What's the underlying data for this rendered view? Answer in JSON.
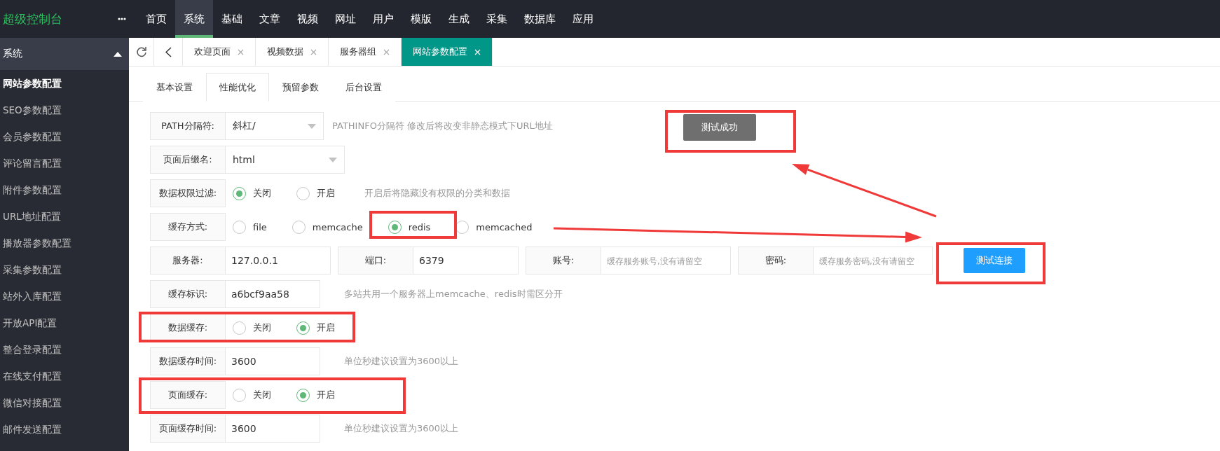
{
  "topbar": {
    "logo": "超级控制台",
    "menu": [
      {
        "label": "首页",
        "selected": false
      },
      {
        "label": "系统",
        "selected": true
      },
      {
        "label": "基础",
        "selected": false
      },
      {
        "label": "文章",
        "selected": false
      },
      {
        "label": "视频",
        "selected": false
      },
      {
        "label": "网址",
        "selected": false
      },
      {
        "label": "用户",
        "selected": false
      },
      {
        "label": "模版",
        "selected": false
      },
      {
        "label": "生成",
        "selected": false
      },
      {
        "label": "采集",
        "selected": false
      },
      {
        "label": "数据库",
        "selected": false
      },
      {
        "label": "应用",
        "selected": false
      }
    ]
  },
  "sidebar": {
    "title": "系统",
    "expanded": true,
    "items": [
      {
        "label": "网站参数配置",
        "selected": true
      },
      {
        "label": "SEO参数配置",
        "selected": false
      },
      {
        "label": "会员参数配置",
        "selected": false
      },
      {
        "label": "评论留言配置",
        "selected": false
      },
      {
        "label": "附件参数配置",
        "selected": false
      },
      {
        "label": "URL地址配置",
        "selected": false
      },
      {
        "label": "播放器参数配置",
        "selected": false
      },
      {
        "label": "采集参数配置",
        "selected": false
      },
      {
        "label": "站外入库配置",
        "selected": false
      },
      {
        "label": "开放API配置",
        "selected": false
      },
      {
        "label": "整合登录配置",
        "selected": false
      },
      {
        "label": "在线支付配置",
        "selected": false
      },
      {
        "label": "微信对接配置",
        "selected": false
      },
      {
        "label": "邮件发送配置",
        "selected": false
      }
    ]
  },
  "page_tabs": [
    {
      "label": "欢迎页面",
      "selected": false
    },
    {
      "label": "视频数据",
      "selected": false
    },
    {
      "label": "服务器组",
      "selected": false
    },
    {
      "label": "网站参数配置",
      "selected": true
    }
  ],
  "sub_tabs": [
    {
      "label": "基本设置",
      "selected": false
    },
    {
      "label": "性能优化",
      "selected": true
    },
    {
      "label": "预留参数",
      "selected": false
    },
    {
      "label": "后台设置",
      "selected": false
    }
  ],
  "form": [
    {
      "kind": "select",
      "label": "PATH分隔符:",
      "value": "斜杠/",
      "hint": "PATHINFO分隔符 修改后将改变非静态模式下URL地址"
    },
    {
      "kind": "select",
      "label": "页面后缀名:",
      "value": "html"
    },
    {
      "kind": "radio",
      "label": "数据权限过滤:",
      "options": [
        {
          "label": "关闭",
          "selected": true
        },
        {
          "label": "开启",
          "selected": false
        }
      ],
      "hint": "开启后将隐藏没有权限的分类和数据"
    },
    {
      "kind": "radio",
      "label": "缓存方式:",
      "options": [
        {
          "label": "file",
          "selected": false
        },
        {
          "label": "memcache",
          "selected": false
        },
        {
          "label": "redis",
          "selected": true
        },
        {
          "label": "memcached",
          "selected": false
        }
      ]
    },
    {
      "kind": "inputs",
      "fields": [
        {
          "label": "服务器:",
          "value": "127.0.0.1"
        },
        {
          "label": "端口:",
          "value": "6379"
        },
        {
          "label": "账号:",
          "placeholder": "缓存服务账号,没有请留空"
        },
        {
          "label": "密码:",
          "placeholder": "缓存服务密码,没有请留空"
        }
      ],
      "button": "测试连接"
    },
    {
      "kind": "text",
      "label": "缓存标识:",
      "value": "a6bcf9aa58",
      "hint": "多站共用一个服务器上memcache、redis时需区分开"
    },
    {
      "kind": "radio",
      "label": "数据缓存:",
      "options": [
        {
          "label": "关闭",
          "selected": false
        },
        {
          "label": "开启",
          "selected": true
        }
      ]
    },
    {
      "kind": "text",
      "label": "数据缓存时间:",
      "value": "3600",
      "hint": "单位秒建议设置为3600以上"
    },
    {
      "kind": "radio",
      "label": "页面缓存:",
      "options": [
        {
          "label": "关闭",
          "selected": false
        },
        {
          "label": "开启",
          "selected": true
        }
      ]
    },
    {
      "kind": "text",
      "label": "页面缓存时间:",
      "value": "3600",
      "hint": "单位秒建议设置为3600以上"
    }
  ],
  "toast": "测试成功"
}
